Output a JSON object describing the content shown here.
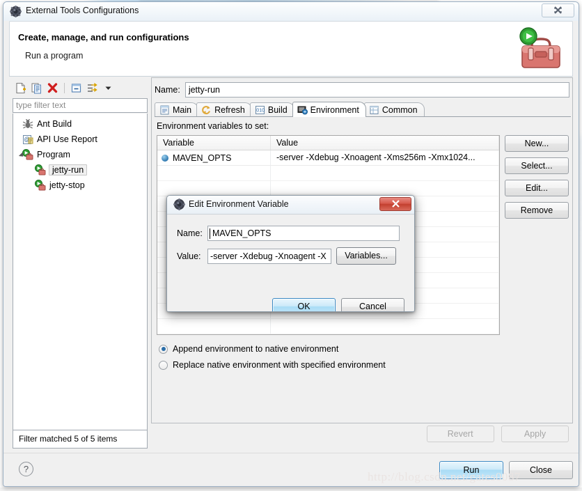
{
  "window": {
    "title": "External Tools Configurations",
    "title_icon": "eclipse-gear-icon",
    "close_label": "✖"
  },
  "banner": {
    "title": "Create, manage, and run configurations",
    "subtitle": "Run a program",
    "art_icon": "toolbox-with-run-icon"
  },
  "sidebar": {
    "toolbar": [
      {
        "name": "new-launch-configuration-icon",
        "label": "New"
      },
      {
        "name": "duplicate-launch-configuration-icon",
        "label": "Duplicate"
      },
      {
        "name": "delete-launch-configuration-icon",
        "label": "Delete"
      },
      {
        "name": "collapse-all-icon",
        "label": "Collapse All"
      },
      {
        "name": "filter-launch-configurations-icon",
        "label": "Filter"
      },
      {
        "name": "view-menu-chevron-down-icon",
        "label": "Menu"
      }
    ],
    "filter_placeholder": "type filter text",
    "filter_value": "",
    "tree": [
      {
        "label": "Ant Build",
        "icon": "ant-build-icon",
        "indent": 0,
        "selected": false,
        "expander": "none"
      },
      {
        "label": "API Use Report",
        "icon": "api-use-report-icon",
        "indent": 0,
        "selected": false,
        "expander": "none"
      },
      {
        "label": "Program",
        "icon": "program-icon",
        "indent": 0,
        "selected": false,
        "expander": "expanded"
      },
      {
        "label": "jetty-run",
        "icon": "program-config-icon",
        "indent": 1,
        "selected": true,
        "expander": "none"
      },
      {
        "label": "jetty-stop",
        "icon": "program-config-icon",
        "indent": 1,
        "selected": false,
        "expander": "none"
      }
    ],
    "status": "Filter matched 5 of 5 items"
  },
  "config": {
    "name_label": "Name:",
    "name_value": "jetty-run",
    "tabs": [
      {
        "label": "Main",
        "icon": "main-tab-icon",
        "active": false
      },
      {
        "label": "Refresh",
        "icon": "refresh-tab-icon",
        "active": false
      },
      {
        "label": "Build",
        "icon": "build-tab-icon",
        "active": false
      },
      {
        "label": "Environment",
        "icon": "environment-tab-icon",
        "active": true
      },
      {
        "label": "Common",
        "icon": "common-tab-icon",
        "active": false
      }
    ],
    "env": {
      "section_label": "Environment variables to set:",
      "columns": [
        "Variable",
        "Value"
      ],
      "rows": [
        {
          "variable": "MAVEN_OPTS",
          "value": "-server -Xdebug -Xnoagent -Xms256m -Xmx1024..."
        }
      ],
      "empty_row_count": 11,
      "buttons": [
        "New...",
        "Select...",
        "Edit...",
        "Remove"
      ],
      "radios": [
        {
          "label": "Append environment to native environment",
          "selected": true
        },
        {
          "label": "Replace native environment with specified environment",
          "selected": false
        }
      ]
    },
    "revert_label": "Revert",
    "apply_label": "Apply"
  },
  "footer": {
    "help_label": "?",
    "run_label": "Run",
    "close_label": "Close"
  },
  "modal": {
    "title": "Edit Environment Variable",
    "title_icon": "eclipse-gear-icon",
    "close_label": "✖",
    "name_label": "Name:",
    "name_value": "MAVEN_OPTS",
    "value_label": "Value:",
    "value_value": "-server -Xdebug -Xnoagent -X",
    "variables_label": "Variables...",
    "ok_label": "OK",
    "cancel_label": "Cancel"
  },
  "watermark": "http://blog.csdn.net/gates0087",
  "colors": {
    "accent_blue": "#2b6ea8",
    "default_button_border": "#3c8ac4",
    "modal_close_red": "#c3402f",
    "window_bg": "#f0f0f0"
  }
}
